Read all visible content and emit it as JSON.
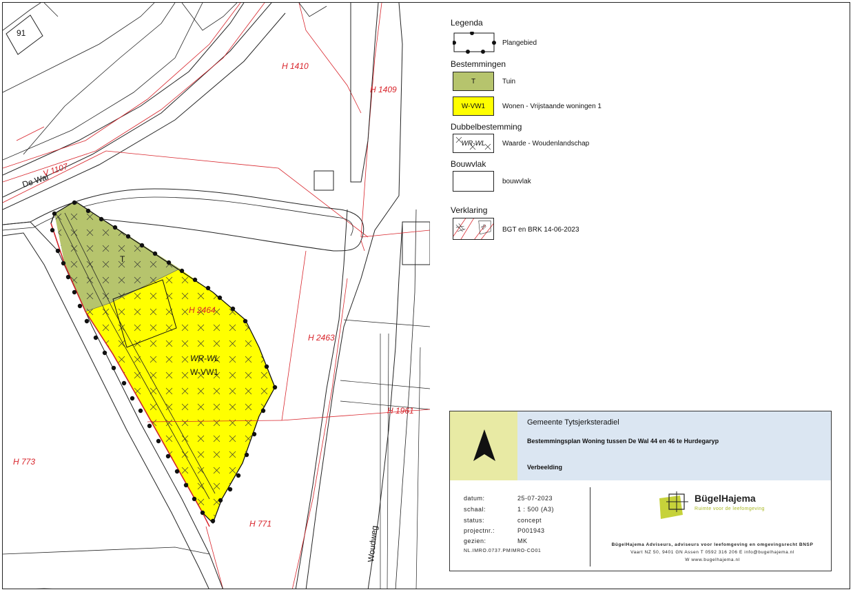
{
  "map": {
    "parcels": [
      "H 1410",
      "H 1409",
      "H 2464",
      "H 2463",
      "H 1961",
      "H 773",
      "H 771"
    ],
    "street_label_dewal": "De Wal",
    "street_parcel_dewal": "V 1107",
    "street_label_woudweg": "Woudweg",
    "house_number": "91",
    "zone_tuin": "T",
    "zone_wrwl": "WR-WL",
    "zone_wvw1": "W-VW1"
  },
  "legend": {
    "title": "Legenda",
    "plangebied": "Plangebied",
    "bestemmingen_head": "Bestemmingen",
    "tuin_code": "T",
    "tuin_label": "Tuin",
    "wvw_code": "W-VW1",
    "wvw_label": "Wonen - Vrijstaande woningen 1",
    "dubbel_head": "Dubbelbestemming",
    "wrwl_code": "WR-WL",
    "wrwl_label": "Waarde - Woudenlandschap",
    "bouwvlak_head": "Bouwvlak",
    "bouwvlak_label": "bouwvlak",
    "verklaring_head": "Verklaring",
    "verklaring_label": "BGT en BRK 14-06-2023",
    "colors": {
      "tuin": "#b6c46d",
      "wvw1": "#ffff00",
      "red_line": "#d8232a"
    }
  },
  "titleblock": {
    "municipality": "Gemeente Tytsjerksteradiel",
    "plan": "Bestemmingsplan Woning tussen De Wal 44 en 46 te Hurdegaryp",
    "stage": "Verbeelding",
    "meta": [
      {
        "k": "datum:",
        "v": "25-07-2023"
      },
      {
        "k": "schaal:",
        "v": "1 : 500 (A3)"
      },
      {
        "k": "status:",
        "v": "concept"
      },
      {
        "k": "projectnr.:",
        "v": "P001943"
      },
      {
        "k": "gezien:",
        "v": "MK"
      }
    ],
    "idn": "NL.IMRO.0737.PMIMRO-CO01",
    "logo_name": "BügelHajema",
    "logo_tag": "Ruimte voor de leefomgeving",
    "firm": "BügelHajema Adviseurs, adviseurs voor leefomgeving en omgevingsrecht BNSP",
    "address": "Vaart NZ 50, 9401 GN Assen  T 0592 316 206  E info@bugelhajema.nl",
    "web": "W www.bugelhajema.nl"
  }
}
